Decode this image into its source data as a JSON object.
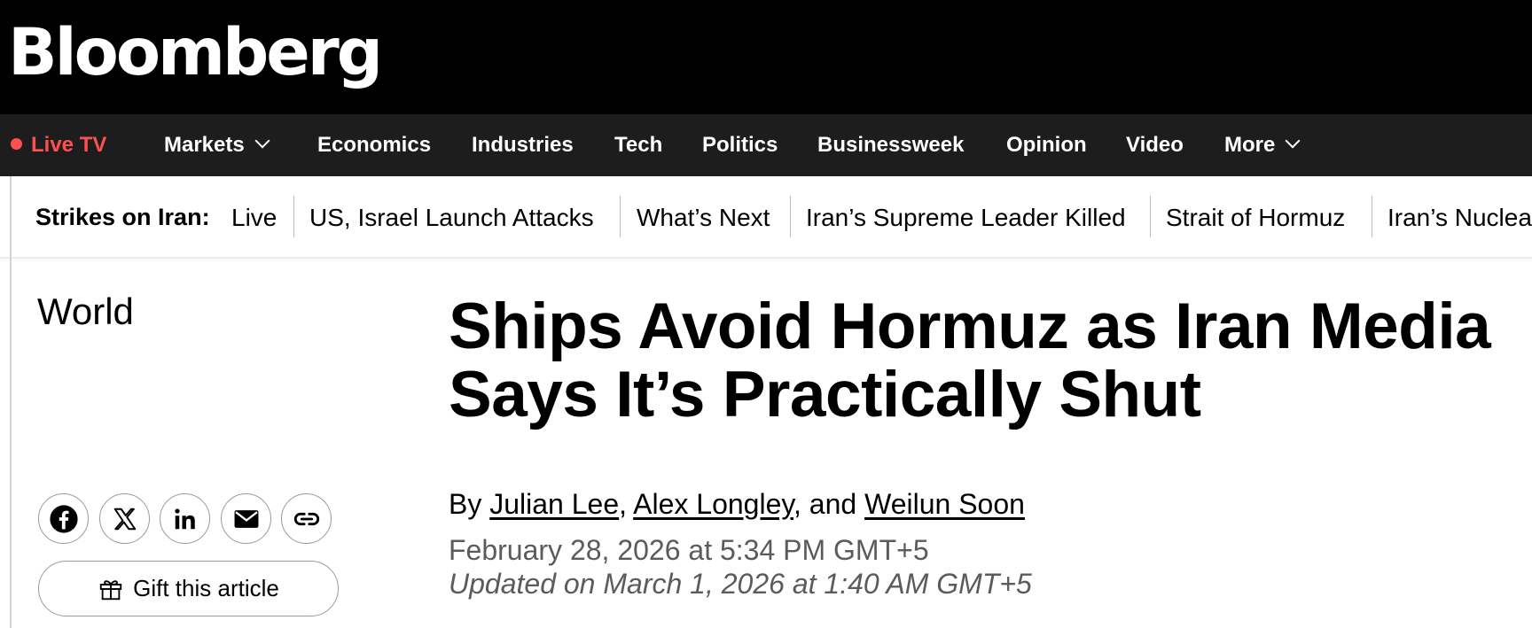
{
  "brand": {
    "logo_text": "Bloomberg"
  },
  "nav": {
    "live_tv": "Live TV",
    "items": [
      "Markets",
      "Economics",
      "Industries",
      "Tech",
      "Politics",
      "Businessweek",
      "Opinion",
      "Video",
      "More"
    ]
  },
  "topics": {
    "label": "Strikes on Iran:",
    "links": [
      "Live",
      "US, Israel Launch Attacks",
      "What’s Next",
      "Iran’s Supreme Leader Killed",
      "Strait of Hormuz",
      "Iran’s Nuclea"
    ]
  },
  "article": {
    "section": "World",
    "headline_line1": "Ships Avoid Hormuz as Iran Media",
    "headline_line2": "Says It’s Practically Shut",
    "byline_prefix": "By ",
    "authors": [
      "Julian Lee",
      "Alex Longley",
      "Weilun Soon"
    ],
    "byline_sep1": ", ",
    "byline_sep2": ", and ",
    "published": "February 28, 2026 at 5:34 PM GMT+5",
    "updated": "Updated on March 1, 2026 at 1:40 AM GMT+5"
  },
  "share": {
    "icons": [
      "facebook-icon",
      "x-icon",
      "linkedin-icon",
      "email-icon",
      "link-icon"
    ],
    "gift_label": "Gift this article"
  },
  "colors": {
    "brand_bar": "#000000",
    "nav_bar": "#1d1d1d",
    "live_red": "#ff5050",
    "meta_gray": "#5b5b5b"
  }
}
